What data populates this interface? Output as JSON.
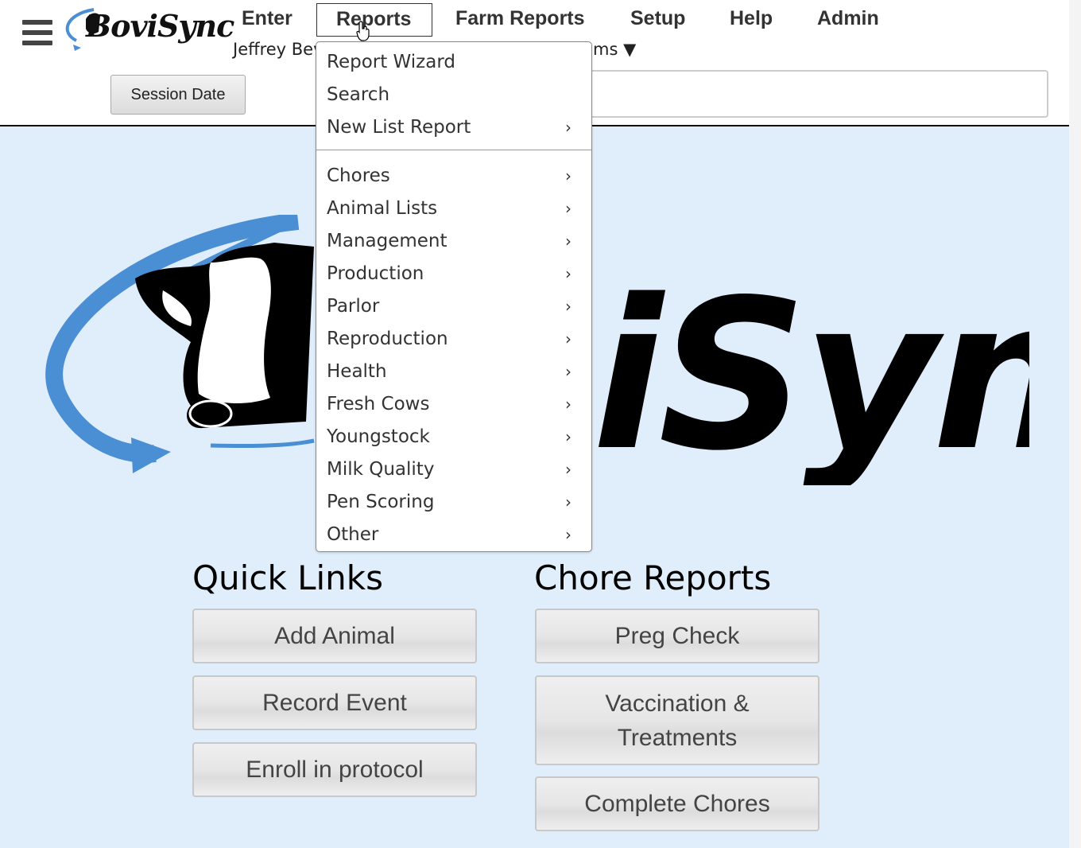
{
  "header": {
    "logo_text": "BoviSync",
    "nav": [
      {
        "label": "Enter"
      },
      {
        "label": "Reports"
      },
      {
        "label": "Farm Reports"
      },
      {
        "label": "Setup"
      },
      {
        "label": "Help"
      },
      {
        "label": "Admin"
      }
    ],
    "user_name_visible": "Jeffrey Bev",
    "farm_selector_visible": "ms ▼",
    "session_date_label": "Session Date"
  },
  "reports_menu": {
    "top_items": [
      {
        "label": "Report Wizard",
        "has_submenu": false
      },
      {
        "label": "Search",
        "has_submenu": false
      },
      {
        "label": "New List Report",
        "has_submenu": true
      }
    ],
    "category_items": [
      {
        "label": "Chores",
        "has_submenu": true
      },
      {
        "label": "Animal Lists",
        "has_submenu": true
      },
      {
        "label": "Management",
        "has_submenu": true
      },
      {
        "label": "Production",
        "has_submenu": true
      },
      {
        "label": "Parlor",
        "has_submenu": true
      },
      {
        "label": "Reproduction",
        "has_submenu": true
      },
      {
        "label": "Health",
        "has_submenu": true
      },
      {
        "label": "Fresh Cows",
        "has_submenu": true
      },
      {
        "label": "Youngstock",
        "has_submenu": true
      },
      {
        "label": "Milk Quality",
        "has_submenu": true
      },
      {
        "label": "Pen Scoring",
        "has_submenu": true
      },
      {
        "label": "Other",
        "has_submenu": true
      }
    ],
    "chevron_glyph": "›"
  },
  "hero": {
    "logo_text": "BoviSync"
  },
  "quick_links": {
    "title": "Quick Links",
    "buttons": [
      {
        "label": "Add Animal"
      },
      {
        "label": "Record Event"
      },
      {
        "label": "Enroll in protocol"
      }
    ]
  },
  "chore_reports": {
    "title": "Chore Reports",
    "buttons": [
      {
        "label": "Preg Check"
      },
      {
        "label": "Vaccination & Treatments"
      },
      {
        "label": "Complete Chores"
      }
    ]
  },
  "colors": {
    "page_bg": "#e0eefb",
    "logo_blue": "#4a8fd4",
    "logo_black": "#000000"
  },
  "icons": [
    "hamburger-menu-icon",
    "chevron-right-icon",
    "hand-pointer-cursor"
  ]
}
